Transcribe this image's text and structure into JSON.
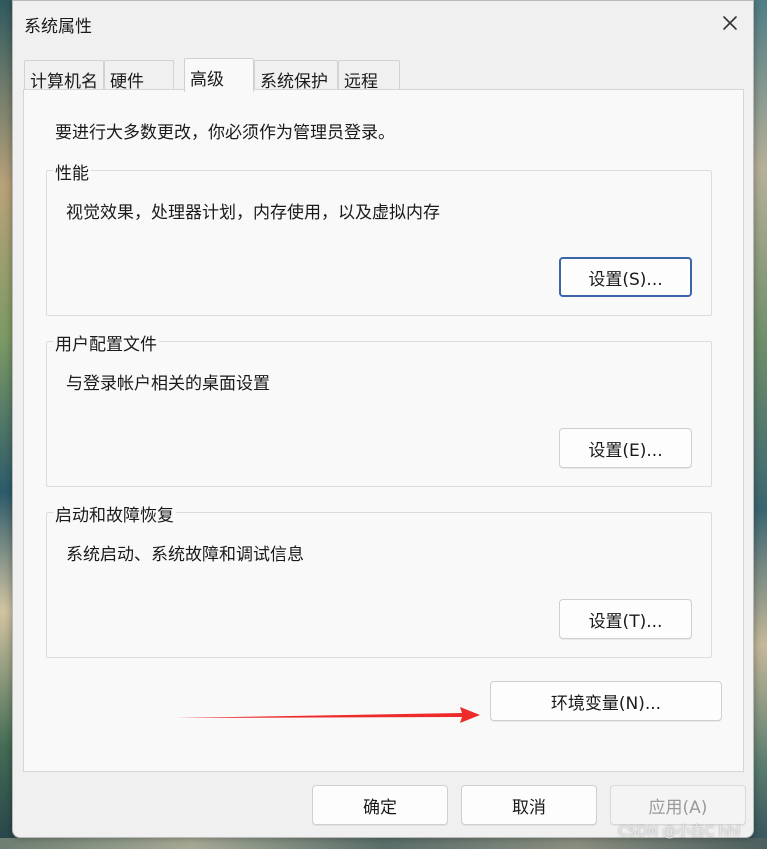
{
  "window": {
    "title": "系统属性"
  },
  "tabs": [
    {
      "label": "计算机名"
    },
    {
      "label": "硬件"
    },
    {
      "label": "高级"
    },
    {
      "label": "系统保护"
    },
    {
      "label": "远程"
    }
  ],
  "active_tab": "高级",
  "advanced": {
    "intro": "要进行大多数更改，你必须作为管理员登录。",
    "groups": [
      {
        "title": "性能",
        "description": "视觉效果，处理器计划，内存使用，以及虚拟内存",
        "button_label": "设置(S)...",
        "focused": true
      },
      {
        "title": "用户配置文件",
        "description": "与登录帐户相关的桌面设置",
        "button_label": "设置(E)..."
      },
      {
        "title": "启动和故障恢复",
        "description": "系统启动、系统故障和调试信息",
        "button_label": "设置(T)..."
      }
    ],
    "env_button_label": "环境变量(N)..."
  },
  "footer": {
    "ok_label": "确定",
    "cancel_label": "取消",
    "apply_label": "应用(A)",
    "apply_enabled": false
  },
  "annotation": {
    "arrow_color": "#ee2b2b"
  },
  "watermark": "CSDN @小白C hhl",
  "colors": {
    "focus_border": "#3a66a8",
    "dialog_bg": "#f0f0f0",
    "panel_bg": "#f9f9f9"
  },
  "icons": {
    "close": "close-icon"
  }
}
